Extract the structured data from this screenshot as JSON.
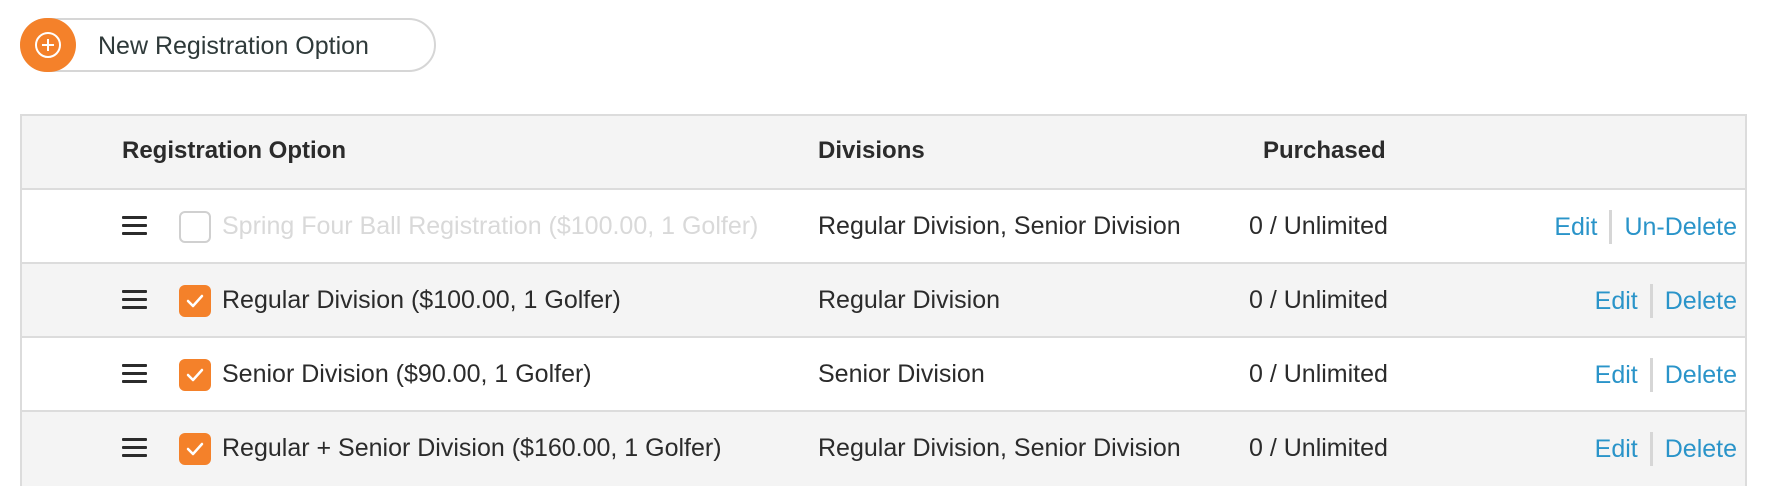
{
  "toolbar": {
    "new_option_label": "New Registration Option",
    "new_option_icon": "plus-circle-icon",
    "accent_color": "#f4812a"
  },
  "table": {
    "headers": {
      "option": "Registration Option",
      "divisions": "Divisions",
      "purchased": "Purchased"
    },
    "rows": [
      {
        "option": "Spring Four Ball Registration ($100.00, 1 Golfer)",
        "divisions": "Regular Division, Senior Division",
        "purchased": "0 / Unlimited",
        "checked": false,
        "deleted": true,
        "edit": "Edit",
        "action": "Un-Delete"
      },
      {
        "option": "Regular Division ($100.00, 1 Golfer)",
        "divisions": "Regular Division",
        "purchased": "0 / Unlimited",
        "checked": true,
        "deleted": false,
        "edit": "Edit",
        "action": "Delete"
      },
      {
        "option": "Senior Division ($90.00, 1 Golfer)",
        "divisions": "Senior Division",
        "purchased": "0 / Unlimited",
        "checked": true,
        "deleted": false,
        "edit": "Edit",
        "action": "Delete"
      },
      {
        "option": "Regular + Senior Division ($160.00, 1 Golfer)",
        "divisions": "Regular Division, Senior Division",
        "purchased": "0 / Unlimited",
        "checked": true,
        "deleted": false,
        "edit": "Edit",
        "action": "Delete"
      }
    ]
  },
  "colors": {
    "link": "#2a94c9",
    "deleted_text": "#d9d9d9",
    "checkbox_on": "#f4812a"
  }
}
